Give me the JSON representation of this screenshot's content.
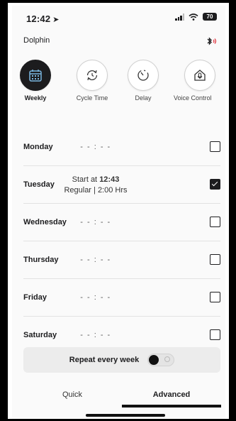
{
  "status_bar": {
    "time": "12:42",
    "battery": "70"
  },
  "header": {
    "device_name": "Dolphin"
  },
  "modes": [
    {
      "label": "Weekly",
      "icon": "calendar-icon",
      "active": true
    },
    {
      "label": "Cycle Time",
      "icon": "refresh-icon",
      "active": false
    },
    {
      "label": "Delay",
      "icon": "timer-icon",
      "active": false
    },
    {
      "label": "Voice Control",
      "icon": "voice-control-icon",
      "active": false
    }
  ],
  "schedule": [
    {
      "day": "Monday",
      "time": "- - : - -",
      "checked": false
    },
    {
      "day": "Tuesday",
      "start_prefix": "Start at",
      "start_time": "12:43",
      "detail": "Regular | 2:00 Hrs",
      "checked": true
    },
    {
      "day": "Wednesday",
      "time": "- - : - -",
      "checked": false
    },
    {
      "day": "Thursday",
      "time": "- - : - -",
      "checked": false
    },
    {
      "day": "Friday",
      "time": "- - : - -",
      "checked": false
    },
    {
      "day": "Saturday",
      "time": "- - : - -",
      "checked": false
    }
  ],
  "repeat": {
    "label": "Repeat every week",
    "enabled": false
  },
  "tabs": {
    "quick": "Quick",
    "advanced": "Advanced",
    "selected": "Advanced"
  },
  "colors": {
    "accent": "#1c1c1e",
    "background": "#fafafa"
  }
}
